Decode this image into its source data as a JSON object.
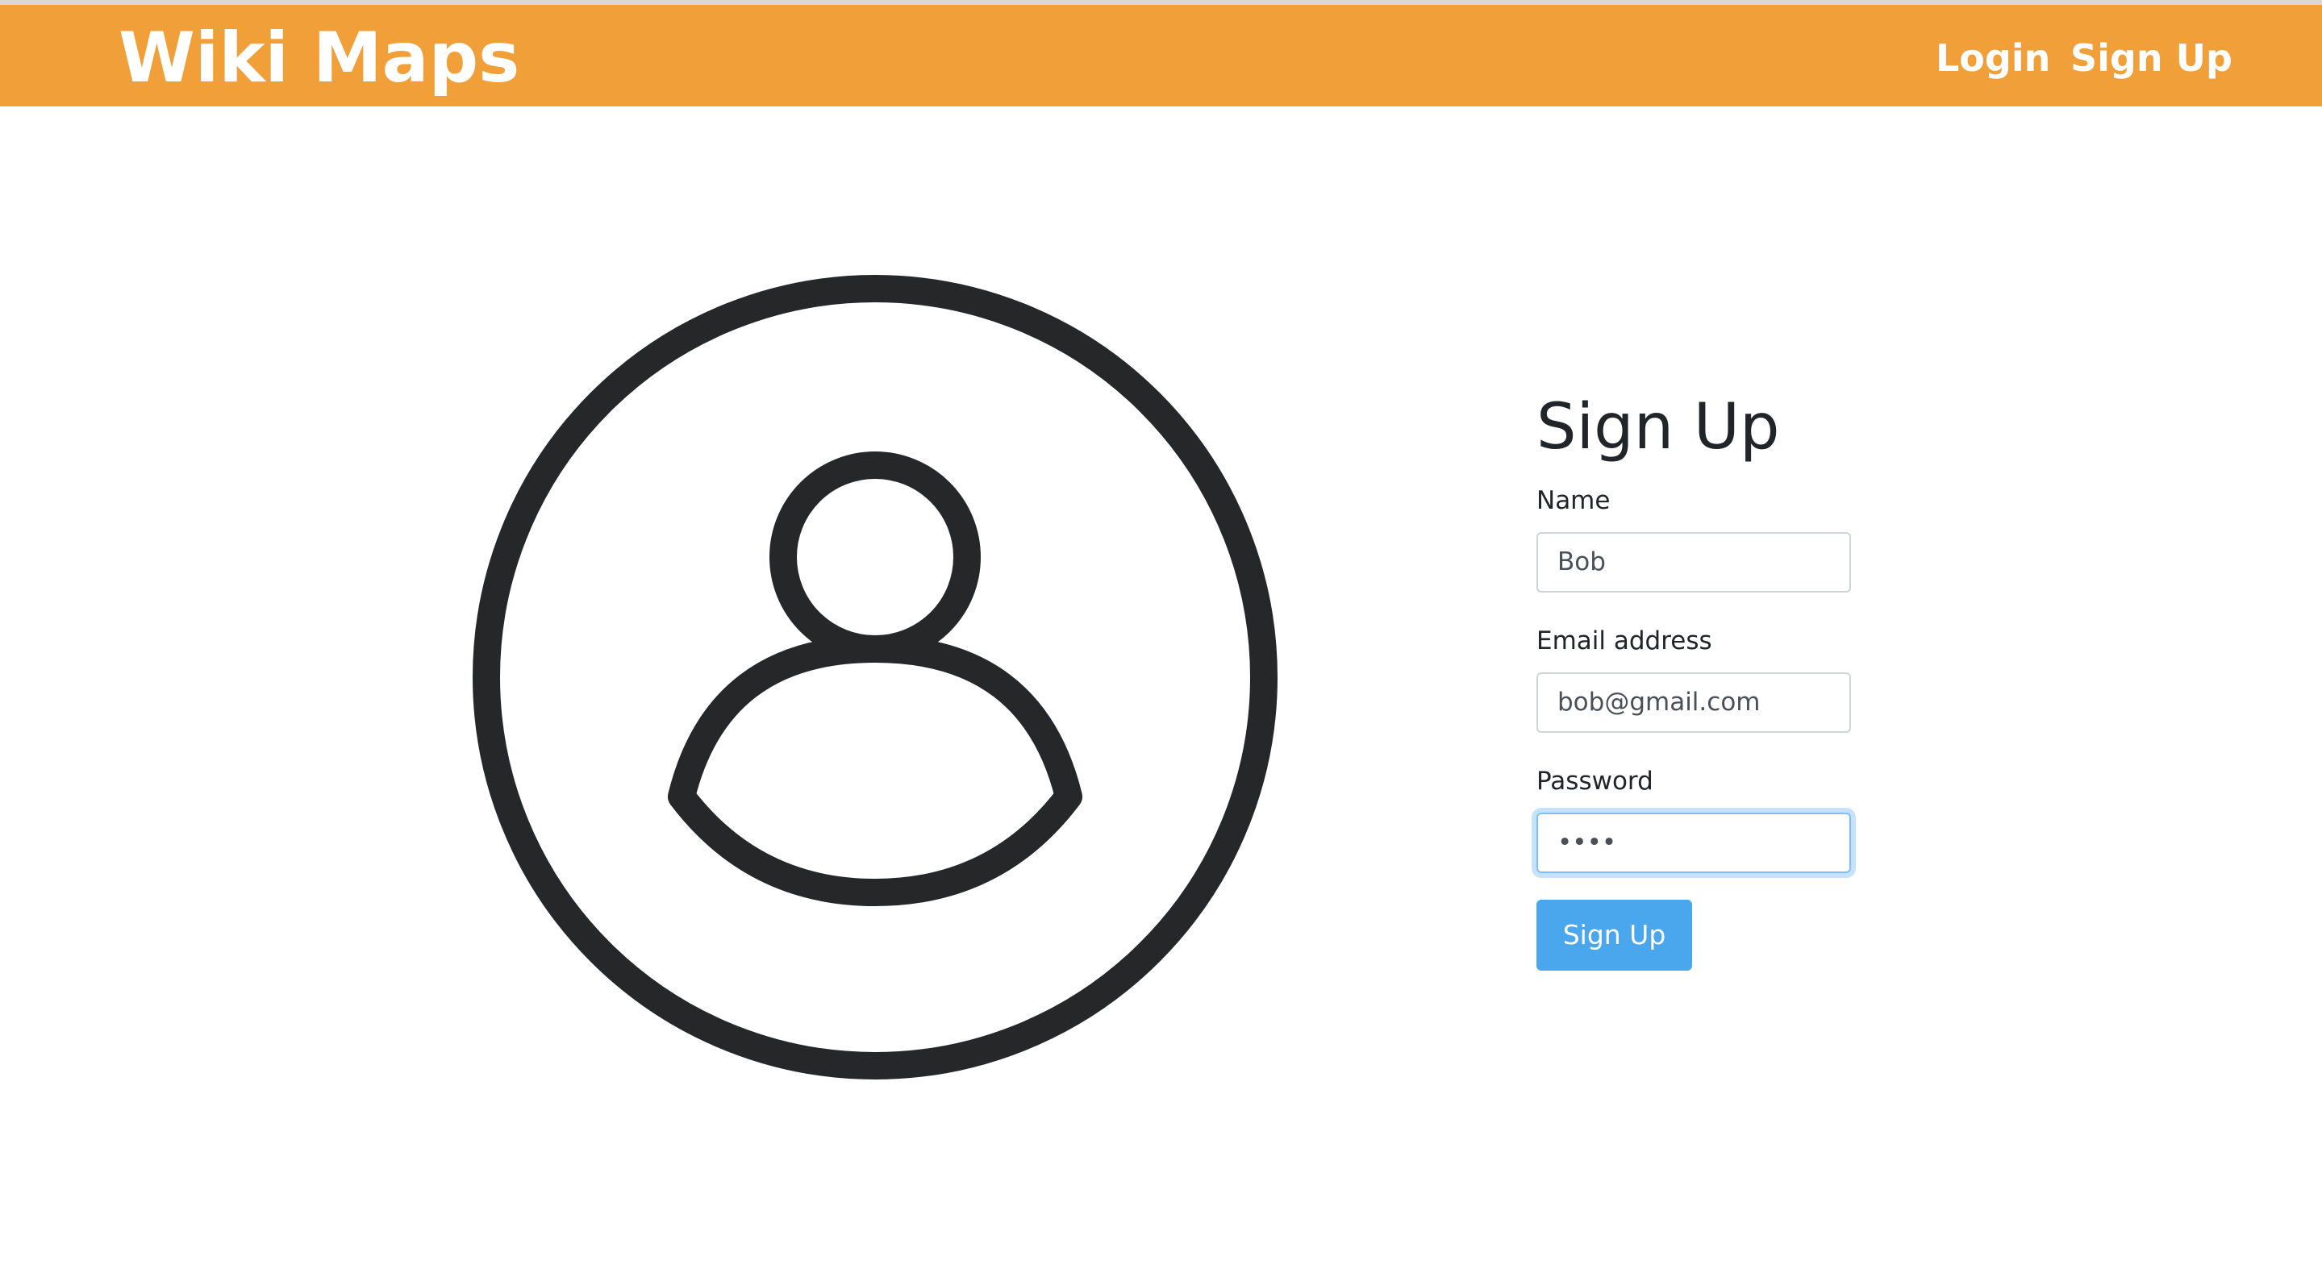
{
  "navbar": {
    "brand": "Wiki Maps",
    "background": "#f19f39",
    "links": [
      {
        "label": "Login"
      },
      {
        "label": "Sign Up"
      }
    ]
  },
  "illustration": {
    "icon": "user-circle-icon",
    "stroke_color": "#262728"
  },
  "form": {
    "title": "Sign Up",
    "fields": [
      {
        "label": "Name",
        "value": "Bob"
      },
      {
        "label": "Email address",
        "value": "bob@gmail.com"
      },
      {
        "label": "Password",
        "value": "••••",
        "focused": true
      }
    ],
    "submit_label": "Sign Up",
    "submit_color": "#4aa7ee"
  }
}
